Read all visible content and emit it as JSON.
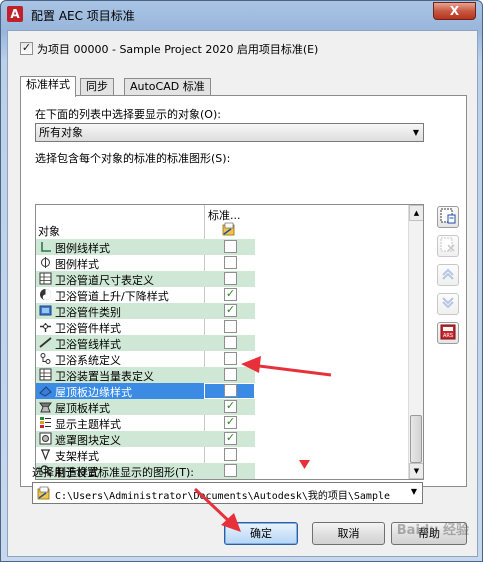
{
  "window": {
    "title": "配置 AEC 项目标准",
    "close_label": "X"
  },
  "enable_checkbox": {
    "checked": true,
    "label": "为项目 00000 - Sample Project 2020 启用项目标准(E)"
  },
  "tabs": [
    {
      "label": "标准样式",
      "active": true
    },
    {
      "label": "同步",
      "active": false
    },
    {
      "label": "AutoCAD 标准",
      "active": false
    }
  ],
  "object_select": {
    "label": "在下面的列表中选择要显示的对象(O):",
    "value": "所有对象"
  },
  "grid": {
    "label": "选择包含每个对象的标准的标准图形(S):",
    "col_object": "对象",
    "col_standard": "标准...",
    "rows": [
      {
        "name": "图例线样式",
        "icon": "legend-line-icon",
        "checked": false,
        "green": true
      },
      {
        "name": "图例样式",
        "icon": "legend-icon",
        "checked": false,
        "green": false
      },
      {
        "name": "卫浴管道尺寸表定义",
        "icon": "table-icon",
        "checked": false,
        "green": true
      },
      {
        "name": "卫浴管道上升/下降样式",
        "icon": "rise-drop-icon",
        "checked": true,
        "green": false
      },
      {
        "name": "卫浴管件类别",
        "icon": "fitting-category-icon",
        "checked": true,
        "green": true
      },
      {
        "name": "卫浴管件样式",
        "icon": "fitting-style-icon",
        "checked": false,
        "green": false
      },
      {
        "name": "卫浴管线样式",
        "icon": "pipe-line-icon",
        "checked": false,
        "green": true
      },
      {
        "name": "卫浴系统定义",
        "icon": "system-icon",
        "checked": false,
        "green": false
      },
      {
        "name": "卫浴装置当量表定义",
        "icon": "table-icon",
        "checked": false,
        "green": true
      },
      {
        "name": "屋顶板边缘样式",
        "icon": "roof-edge-icon",
        "checked": false,
        "green": false,
        "selected": true
      },
      {
        "name": "屋顶板样式",
        "icon": "roof-slab-icon",
        "checked": true,
        "green": true
      },
      {
        "name": "显示主题样式",
        "icon": "theme-icon",
        "checked": true,
        "green": false
      },
      {
        "name": "遮罩图块定义",
        "icon": "mask-block-icon",
        "checked": true,
        "green": true
      },
      {
        "name": "支架样式",
        "icon": "support-icon",
        "checked": false,
        "green": false
      },
      {
        "name": "制造样式",
        "icon": "fabrication-icon",
        "checked": false,
        "green": true
      }
    ]
  },
  "path_select": {
    "label": "选择用于设置标准显示的图形(T):",
    "value": "C:\\Users\\Administrator\\Documents\\Autodesk\\我的项目\\Sample"
  },
  "buttons": {
    "ok": "确定",
    "cancel": "取消",
    "help": "帮助"
  },
  "watermark": "Baidu 经验",
  "colors": {
    "row_green": "#cfe8d6",
    "selection": "#3b8be5",
    "arrow_red": "#e8303a"
  }
}
